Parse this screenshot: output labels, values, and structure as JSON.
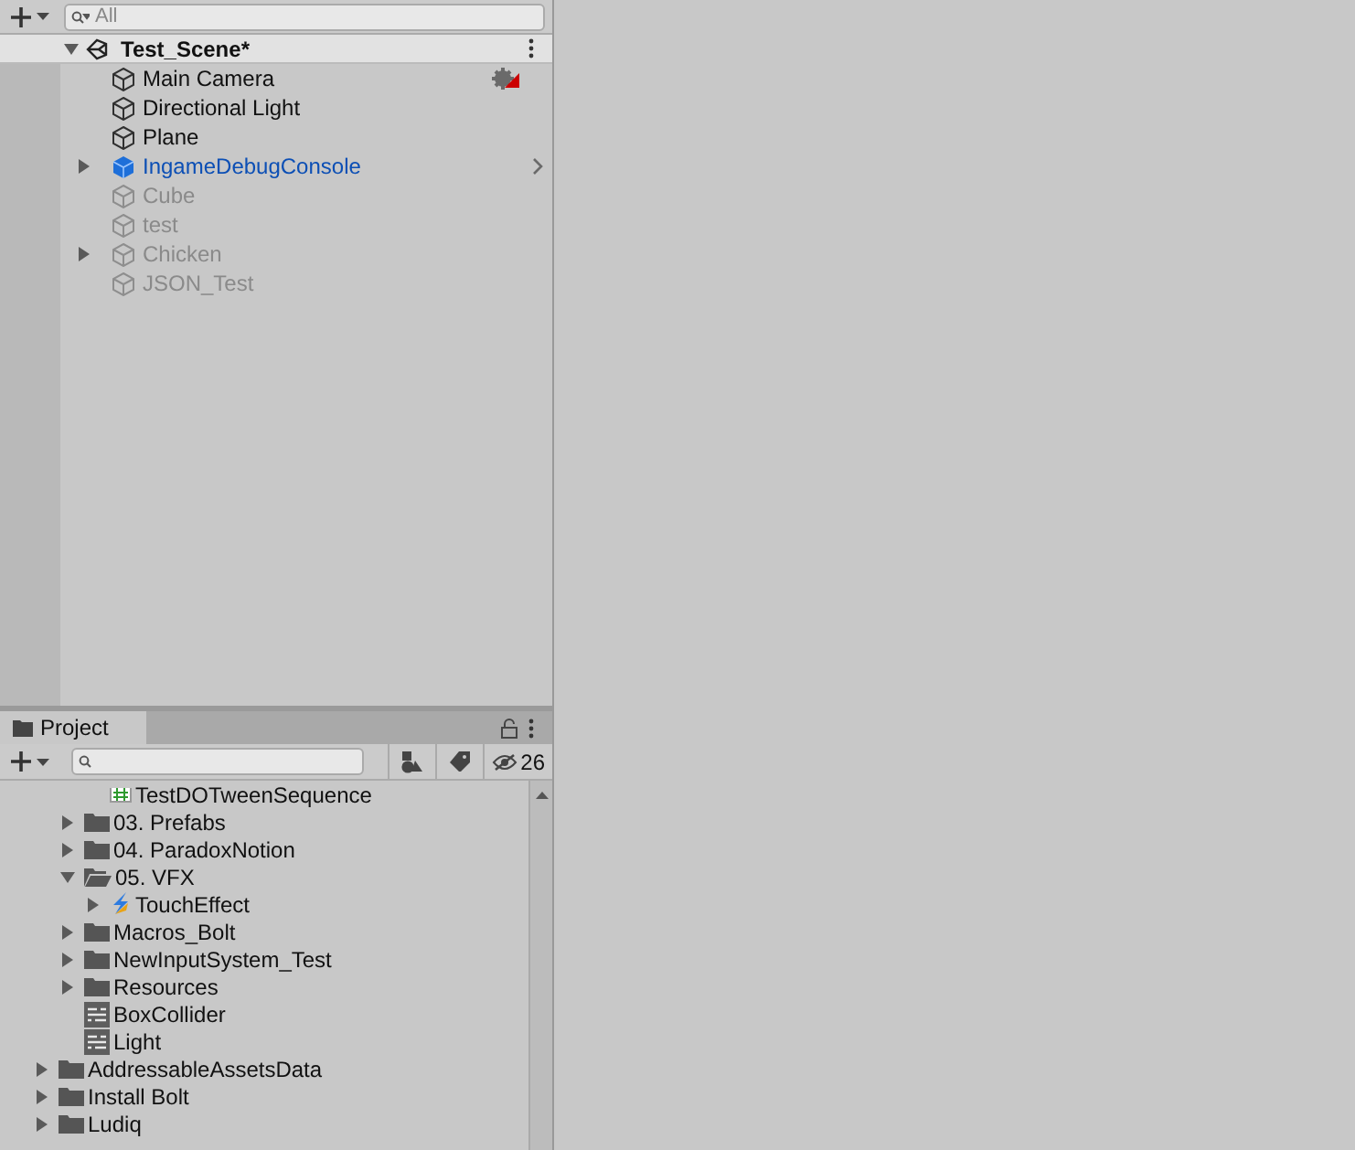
{
  "hierarchy": {
    "search": {
      "placeholder": "All"
    },
    "scene": {
      "label": "Test_Scene*",
      "expanded": true,
      "children": [
        {
          "label": "Main Camera",
          "kind": "gameobject",
          "active": true,
          "warning": true
        },
        {
          "label": "Directional Light",
          "kind": "gameobject",
          "active": true,
          "warning": false
        },
        {
          "label": "Plane",
          "kind": "gameobject",
          "active": true,
          "warning": false
        },
        {
          "label": "IngameDebugConsole",
          "kind": "prefab",
          "active": true,
          "warning": false,
          "expanded": false
        },
        {
          "label": "Cube",
          "kind": "gameobject",
          "active": false,
          "warning": false
        },
        {
          "label": "test",
          "kind": "gameobject",
          "active": false,
          "warning": false
        },
        {
          "label": "Chicken",
          "kind": "gameobject",
          "active": false,
          "warning": false,
          "expanded": false
        },
        {
          "label": "JSON_Test",
          "kind": "gameobject",
          "active": false,
          "warning": false
        }
      ]
    }
  },
  "project": {
    "tab": "Project",
    "hidden_count": "26",
    "tree": [
      {
        "children": [
          {
            "children": [
              {
                "label": "TestDOTweenSequence",
                "kind": "script"
              }
            ]
          },
          {
            "label": "03. Prefabs",
            "kind": "folder",
            "expanded": false
          },
          {
            "label": "04. ParadoxNotion",
            "kind": "folder",
            "expanded": false
          },
          {
            "label": "05. VFX",
            "kind": "folder",
            "expanded": true,
            "children": [
              {
                "label": "TouchEffect",
                "kind": "vfx",
                "expanded": false
              }
            ]
          },
          {
            "label": "Macros_Bolt",
            "kind": "folder",
            "expanded": false
          },
          {
            "label": "NewInputSystem_Test",
            "kind": "folder",
            "expanded": false
          },
          {
            "label": "Resources",
            "kind": "folder",
            "expanded": false
          },
          {
            "label": "BoxCollider",
            "kind": "preset"
          },
          {
            "label": "Light",
            "kind": "preset"
          }
        ]
      },
      {
        "label": "AddressableAssetsData",
        "kind": "folder",
        "expanded": false
      },
      {
        "label": "Install Bolt",
        "kind": "folder",
        "expanded": false
      },
      {
        "label": "Ludiq",
        "kind": "folder",
        "expanded": false
      }
    ]
  }
}
